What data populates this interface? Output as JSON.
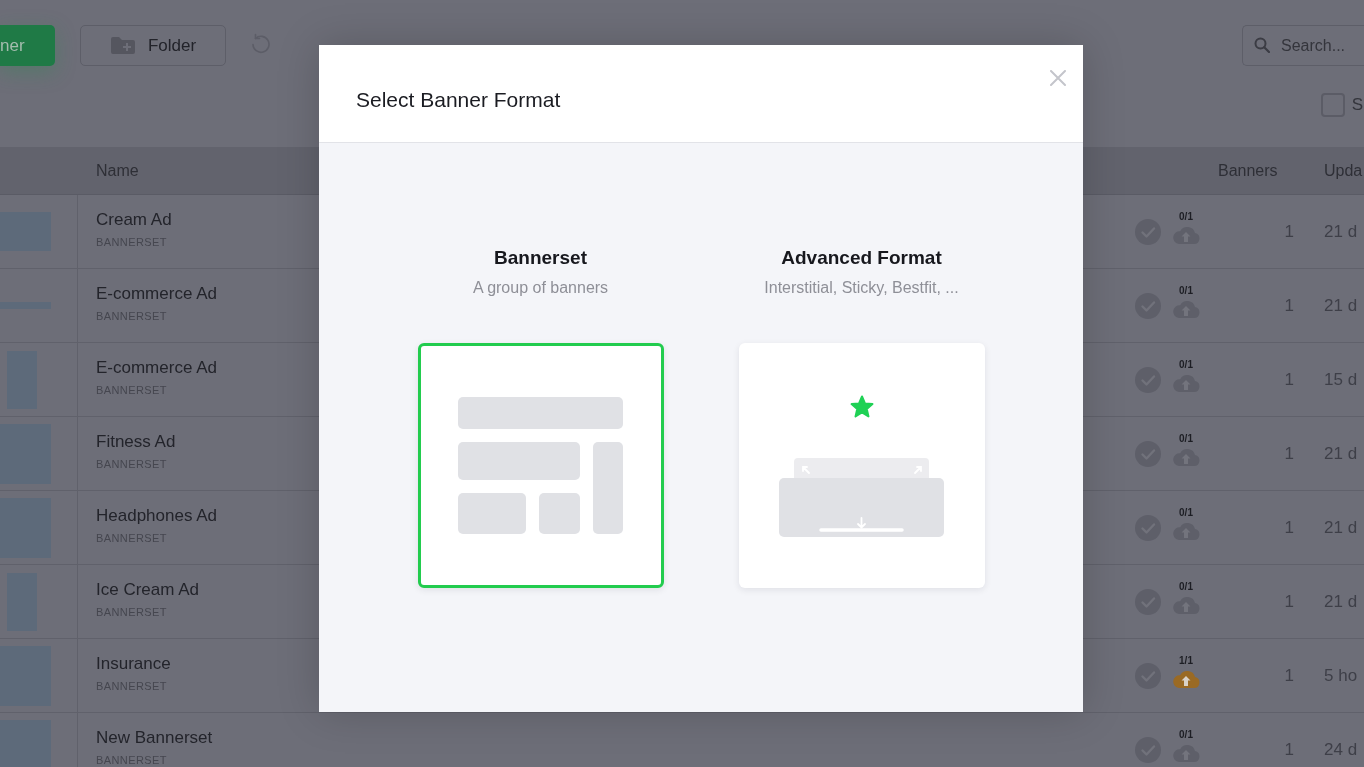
{
  "toolbar": {
    "create_button": "ner",
    "folder_button": "Folder",
    "search": {
      "placeholder": "Search..."
    },
    "filter": {
      "checked": false,
      "label": "S"
    }
  },
  "table": {
    "columns": [
      {
        "label": "Name"
      },
      {
        "label": "Banners"
      },
      {
        "label": "Upda"
      }
    ],
    "rows": [
      {
        "name": "Cream Ad",
        "type": "BANNERSET",
        "thumbnail": {
          "kind": "wide"
        },
        "uploads": "0/1",
        "uploaded": false,
        "banners": "1",
        "column_3": "21 d"
      },
      {
        "name": "E-commerce Ad",
        "type": "BANNERSET",
        "thumbnail": {
          "kind": "strip"
        },
        "uploads": "0/1",
        "uploaded": false,
        "banners": "1",
        "column_3": "21 d"
      },
      {
        "name": "E-commerce Ad",
        "type": "BANNERSET",
        "thumbnail": {
          "kind": "tall"
        },
        "uploads": "0/1",
        "uploaded": false,
        "banners": "1",
        "column_3": "15 d"
      },
      {
        "name": "Fitness Ad",
        "type": "BANNERSET",
        "thumbnail": {
          "kind": "square"
        },
        "uploads": "0/1",
        "uploaded": false,
        "banners": "1",
        "column_3": "21 d"
      },
      {
        "name": "Headphones Ad",
        "type": "BANNERSET",
        "thumbnail": {
          "kind": "square"
        },
        "uploads": "0/1",
        "uploaded": false,
        "banners": "1",
        "column_3": "21 d"
      },
      {
        "name": "Ice Cream Ad",
        "type": "BANNERSET",
        "thumbnail": {
          "kind": "tall"
        },
        "uploads": "0/1",
        "uploaded": false,
        "banners": "1",
        "column_3": "21 d"
      },
      {
        "name": "Insurance",
        "type": "BANNERSET",
        "thumbnail": {
          "kind": "square"
        },
        "uploads": "1/1",
        "uploaded": true,
        "banners": "1",
        "column_3": "5 ho"
      },
      {
        "name": "New Bannerset",
        "type": "BANNERSET",
        "thumbnail": {
          "kind": "square"
        },
        "uploads": "0/1",
        "uploaded": false,
        "banners": "1",
        "column_3": "24 d"
      }
    ]
  },
  "modal": {
    "title": "Select Banner Format",
    "options": [
      {
        "title": "Bannerset",
        "subtitle": "A group of banners",
        "kind": "grid",
        "selected": true
      },
      {
        "title": "Advanced Format",
        "subtitle": "Interstitial, Sticky, Bestfit, ...",
        "kind": "advanced",
        "selected": false
      }
    ]
  }
}
